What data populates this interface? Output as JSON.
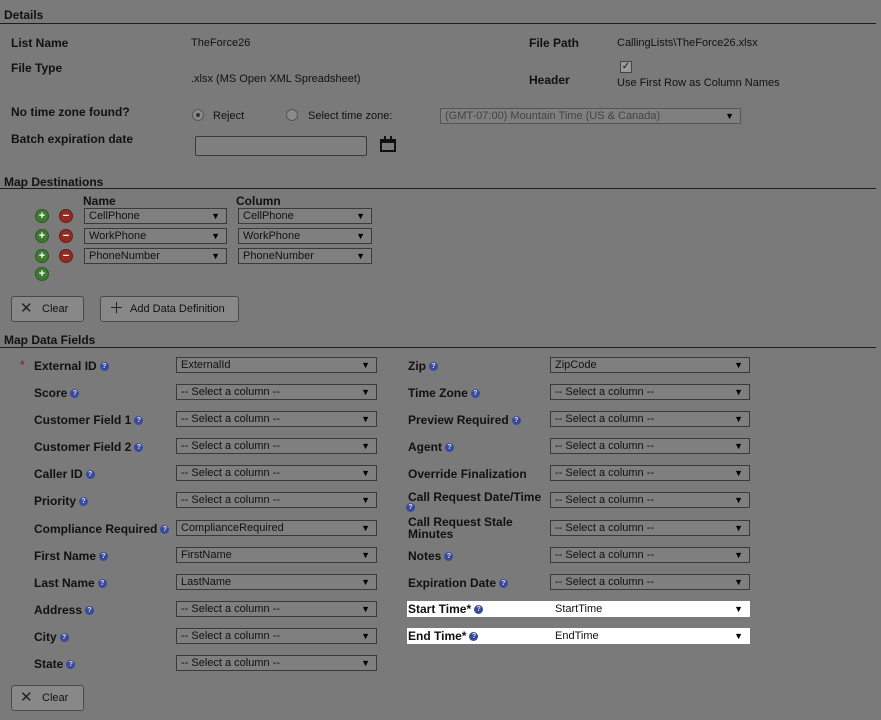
{
  "details": {
    "section_title": "Details",
    "list_name_label": "List Name",
    "list_name_value": "TheForce26",
    "file_path_label": "File Path",
    "file_path_value": "CallingLists\\TheForce26.xlsx",
    "file_type_label": "File Type",
    "file_type_value": ".xlsx (MS Open XML Spreadsheet)",
    "header_label": "Header",
    "header_checkbox_label": "Use First Row as Column Names",
    "header_checked": true,
    "no_tz_label": "No time zone found?",
    "reject_label": "Reject",
    "select_tz_label": "Select time zone:",
    "tz_value": "(GMT-07:00) Mountain Time (US & Canada)",
    "batch_exp_label": "Batch expiration date",
    "batch_exp_value": ""
  },
  "destinations": {
    "section_title": "Map Destinations",
    "name_header": "Name",
    "column_header": "Column",
    "rows": [
      {
        "name": "CellPhone",
        "column": "CellPhone"
      },
      {
        "name": "WorkPhone",
        "column": "WorkPhone"
      },
      {
        "name": "PhoneNumber",
        "column": "PhoneNumber"
      }
    ],
    "clear_label": "Clear",
    "add_label": "Add Data Definition"
  },
  "data_fields": {
    "section_title": "Map Data Fields",
    "left": [
      {
        "label": "External ID",
        "value": "ExternalId",
        "required": true
      },
      {
        "label": "Score",
        "value": "-- Select a column --"
      },
      {
        "label": "Customer Field 1",
        "value": "-- Select a column --"
      },
      {
        "label": "Customer Field 2",
        "value": "-- Select a column --"
      },
      {
        "label": "Caller ID",
        "value": "-- Select a column --"
      },
      {
        "label": "Priority",
        "value": "-- Select a column --"
      },
      {
        "label": "Compliance Required",
        "value": "ComplianceRequired"
      },
      {
        "label": "First Name",
        "value": "FirstName"
      },
      {
        "label": "Last Name",
        "value": "LastName"
      },
      {
        "label": "Address",
        "value": "-- Select a column --"
      },
      {
        "label": "City",
        "value": "-- Select a column --"
      },
      {
        "label": "State",
        "value": "-- Select a column --"
      }
    ],
    "right": [
      {
        "label": "Zip",
        "value": "ZipCode"
      },
      {
        "label": "Time Zone",
        "value": "-- Select a column --"
      },
      {
        "label": "Preview Required",
        "value": "-- Select a column --"
      },
      {
        "label": "Agent",
        "value": "-- Select a column --"
      },
      {
        "label": "Override Finalization",
        "value": "-- Select a column --"
      },
      {
        "label": "Call Request Date/Time",
        "value": "-- Select a column --"
      },
      {
        "label": "Call Request Stale Minutes",
        "value": "-- Select a column --"
      },
      {
        "label": "Notes",
        "value": "-- Select a column --"
      },
      {
        "label": "Expiration Date",
        "value": "-- Select a column --"
      },
      {
        "label": "Start Time*",
        "value": "StartTime",
        "highlight": true
      },
      {
        "label": "End Time*",
        "value": "EndTime",
        "highlight": true
      }
    ],
    "clear_label": "Clear"
  },
  "icons": {
    "info": "info-icon",
    "add": "plus-circle-icon",
    "remove": "minus-circle-icon",
    "calendar": "calendar-icon",
    "clear": "x-icon",
    "add_definition": "plus-icon",
    "dropdown": "chevron-down-icon"
  }
}
